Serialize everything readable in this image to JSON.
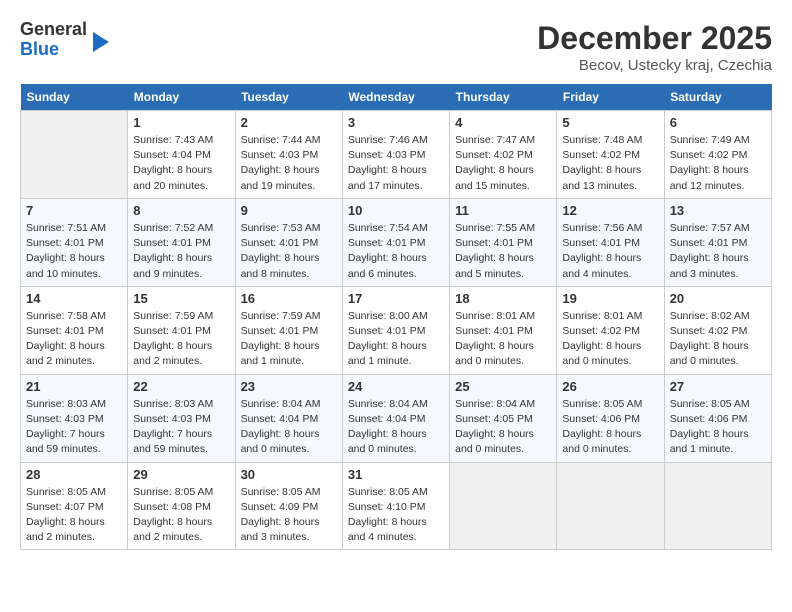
{
  "header": {
    "logo_line1": "General",
    "logo_line2": "Blue",
    "month": "December 2025",
    "location": "Becov, Ustecky kraj, Czechia"
  },
  "weekdays": [
    "Sunday",
    "Monday",
    "Tuesday",
    "Wednesday",
    "Thursday",
    "Friday",
    "Saturday"
  ],
  "weeks": [
    [
      {
        "day": "",
        "info": ""
      },
      {
        "day": "1",
        "info": "Sunrise: 7:43 AM\nSunset: 4:04 PM\nDaylight: 8 hours\nand 20 minutes."
      },
      {
        "day": "2",
        "info": "Sunrise: 7:44 AM\nSunset: 4:03 PM\nDaylight: 8 hours\nand 19 minutes."
      },
      {
        "day": "3",
        "info": "Sunrise: 7:46 AM\nSunset: 4:03 PM\nDaylight: 8 hours\nand 17 minutes."
      },
      {
        "day": "4",
        "info": "Sunrise: 7:47 AM\nSunset: 4:02 PM\nDaylight: 8 hours\nand 15 minutes."
      },
      {
        "day": "5",
        "info": "Sunrise: 7:48 AM\nSunset: 4:02 PM\nDaylight: 8 hours\nand 13 minutes."
      },
      {
        "day": "6",
        "info": "Sunrise: 7:49 AM\nSunset: 4:02 PM\nDaylight: 8 hours\nand 12 minutes."
      }
    ],
    [
      {
        "day": "7",
        "info": "Sunrise: 7:51 AM\nSunset: 4:01 PM\nDaylight: 8 hours\nand 10 minutes."
      },
      {
        "day": "8",
        "info": "Sunrise: 7:52 AM\nSunset: 4:01 PM\nDaylight: 8 hours\nand 9 minutes."
      },
      {
        "day": "9",
        "info": "Sunrise: 7:53 AM\nSunset: 4:01 PM\nDaylight: 8 hours\nand 8 minutes."
      },
      {
        "day": "10",
        "info": "Sunrise: 7:54 AM\nSunset: 4:01 PM\nDaylight: 8 hours\nand 6 minutes."
      },
      {
        "day": "11",
        "info": "Sunrise: 7:55 AM\nSunset: 4:01 PM\nDaylight: 8 hours\nand 5 minutes."
      },
      {
        "day": "12",
        "info": "Sunrise: 7:56 AM\nSunset: 4:01 PM\nDaylight: 8 hours\nand 4 minutes."
      },
      {
        "day": "13",
        "info": "Sunrise: 7:57 AM\nSunset: 4:01 PM\nDaylight: 8 hours\nand 3 minutes."
      }
    ],
    [
      {
        "day": "14",
        "info": "Sunrise: 7:58 AM\nSunset: 4:01 PM\nDaylight: 8 hours\nand 2 minutes."
      },
      {
        "day": "15",
        "info": "Sunrise: 7:59 AM\nSunset: 4:01 PM\nDaylight: 8 hours\nand 2 minutes."
      },
      {
        "day": "16",
        "info": "Sunrise: 7:59 AM\nSunset: 4:01 PM\nDaylight: 8 hours\nand 1 minute."
      },
      {
        "day": "17",
        "info": "Sunrise: 8:00 AM\nSunset: 4:01 PM\nDaylight: 8 hours\nand 1 minute."
      },
      {
        "day": "18",
        "info": "Sunrise: 8:01 AM\nSunset: 4:01 PM\nDaylight: 8 hours\nand 0 minutes."
      },
      {
        "day": "19",
        "info": "Sunrise: 8:01 AM\nSunset: 4:02 PM\nDaylight: 8 hours\nand 0 minutes."
      },
      {
        "day": "20",
        "info": "Sunrise: 8:02 AM\nSunset: 4:02 PM\nDaylight: 8 hours\nand 0 minutes."
      }
    ],
    [
      {
        "day": "21",
        "info": "Sunrise: 8:03 AM\nSunset: 4:03 PM\nDaylight: 7 hours\nand 59 minutes."
      },
      {
        "day": "22",
        "info": "Sunrise: 8:03 AM\nSunset: 4:03 PM\nDaylight: 7 hours\nand 59 minutes."
      },
      {
        "day": "23",
        "info": "Sunrise: 8:04 AM\nSunset: 4:04 PM\nDaylight: 8 hours\nand 0 minutes."
      },
      {
        "day": "24",
        "info": "Sunrise: 8:04 AM\nSunset: 4:04 PM\nDaylight: 8 hours\nand 0 minutes."
      },
      {
        "day": "25",
        "info": "Sunrise: 8:04 AM\nSunset: 4:05 PM\nDaylight: 8 hours\nand 0 minutes."
      },
      {
        "day": "26",
        "info": "Sunrise: 8:05 AM\nSunset: 4:06 PM\nDaylight: 8 hours\nand 0 minutes."
      },
      {
        "day": "27",
        "info": "Sunrise: 8:05 AM\nSunset: 4:06 PM\nDaylight: 8 hours\nand 1 minute."
      }
    ],
    [
      {
        "day": "28",
        "info": "Sunrise: 8:05 AM\nSunset: 4:07 PM\nDaylight: 8 hours\nand 2 minutes."
      },
      {
        "day": "29",
        "info": "Sunrise: 8:05 AM\nSunset: 4:08 PM\nDaylight: 8 hours\nand 2 minutes."
      },
      {
        "day": "30",
        "info": "Sunrise: 8:05 AM\nSunset: 4:09 PM\nDaylight: 8 hours\nand 3 minutes."
      },
      {
        "day": "31",
        "info": "Sunrise: 8:05 AM\nSunset: 4:10 PM\nDaylight: 8 hours\nand 4 minutes."
      },
      {
        "day": "",
        "info": ""
      },
      {
        "day": "",
        "info": ""
      },
      {
        "day": "",
        "info": ""
      }
    ]
  ]
}
